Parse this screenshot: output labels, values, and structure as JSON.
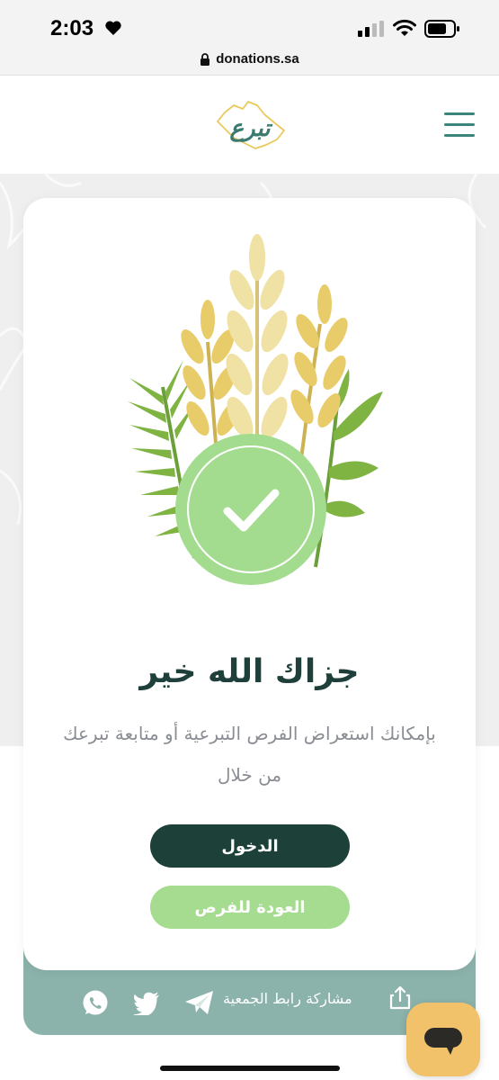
{
  "status_bar": {
    "time": "2:03",
    "icons": [
      "heart-icon",
      "cellular-signal-icon",
      "wifi-icon",
      "battery-icon"
    ]
  },
  "browser": {
    "url": "donations.sa",
    "icons": [
      "lock-icon"
    ]
  },
  "header": {
    "logo_text": "تبرع",
    "icons": [
      "hamburger-menu-icon"
    ]
  },
  "card": {
    "title": "جزاك الله خير",
    "description": "بإمكانك استعراض الفرص التبرعية أو متابعة تبرعك من خلال",
    "login_button": "الدخول",
    "back_button": "العودة للفرص",
    "icons": [
      "wheat-illustration",
      "checkmark-icon"
    ]
  },
  "share_bar": {
    "label": "مشاركة رابط الجمعية",
    "icons": [
      "share-icon",
      "telegram-icon",
      "twitter-icon",
      "whatsapp-icon"
    ]
  },
  "chat": {
    "icons": [
      "chat-bubble-icon"
    ]
  },
  "colors": {
    "primary_dark": "#1d4039",
    "accent_green": "#a5dc8f",
    "teal": "#3c857a",
    "share_bar_bg": "#8cb2ac",
    "chat_yellow": "#f1c26a"
  }
}
